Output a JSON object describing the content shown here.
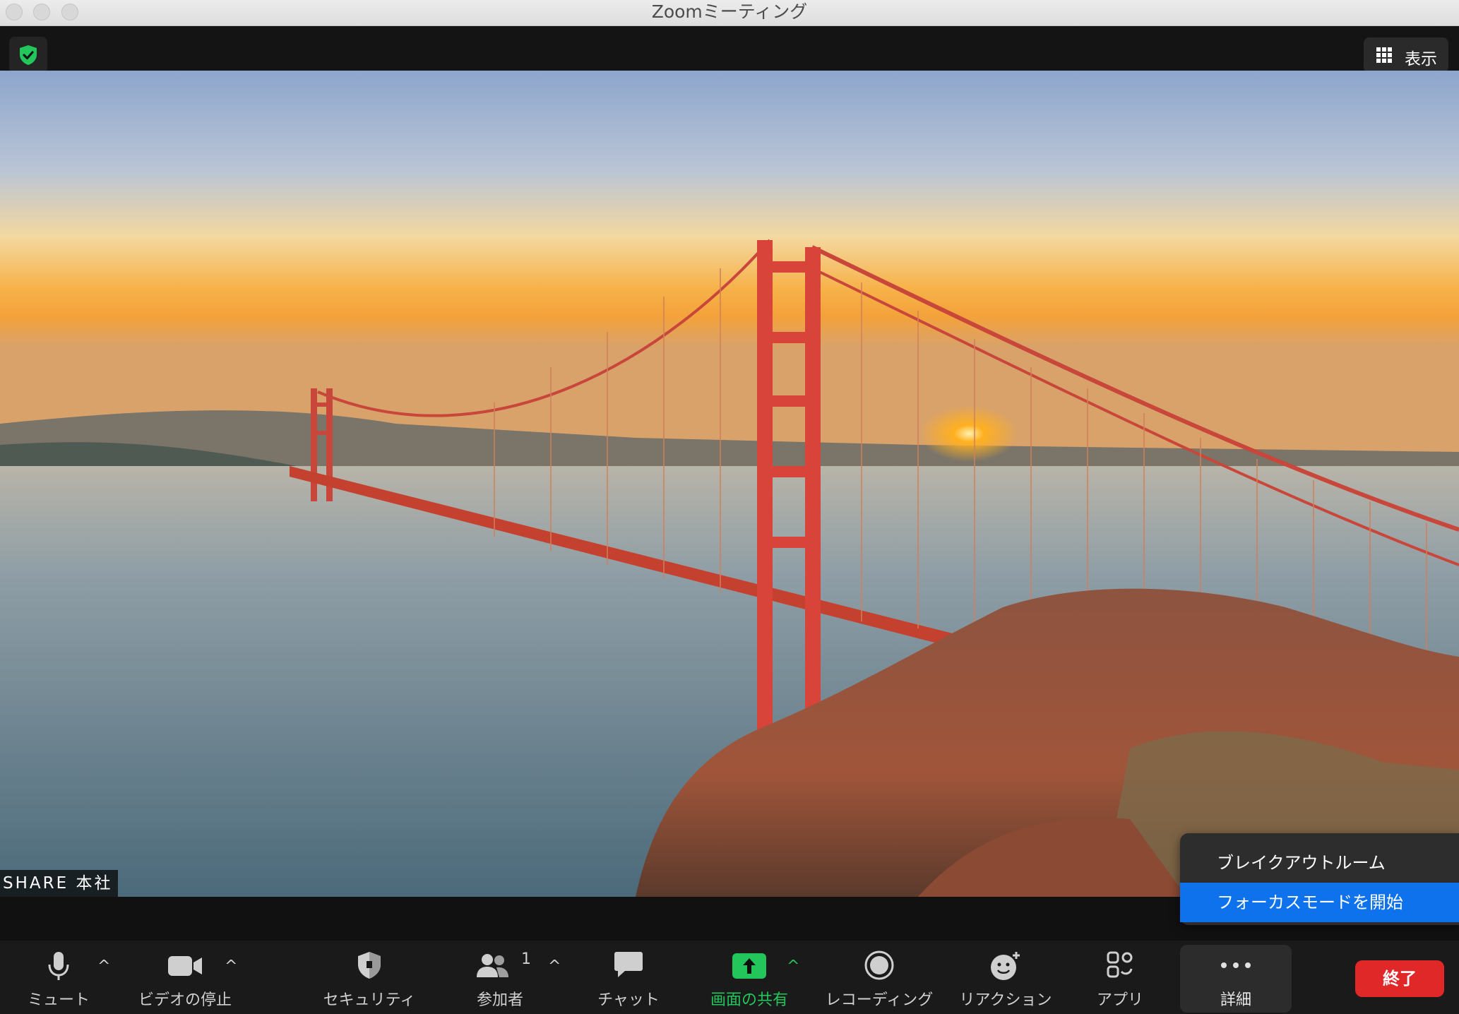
{
  "window": {
    "title": "Zoomミーティング"
  },
  "topbar": {
    "view_label": "表示"
  },
  "video": {
    "participant_name": "SHARE 本社"
  },
  "more_menu": {
    "items": [
      {
        "label": "ブレイクアウトルーム"
      },
      {
        "label": "フォーカスモードを開始"
      }
    ]
  },
  "toolbar": {
    "mute": "ミュート",
    "stop_video": "ビデオの停止",
    "security": "セキュリティ",
    "participants": "参加者",
    "participant_count": "1",
    "chat": "チャット",
    "share_screen": "画面の共有",
    "recording": "レコーディング",
    "reactions": "リアクション",
    "apps": "アプリ",
    "more": "詳細",
    "end": "終了"
  },
  "colors": {
    "share_green": "#22c65b",
    "end_red": "#e02828",
    "menu_highlight": "#0e72ed",
    "encryption_shield": "#22c65b"
  },
  "icons": {
    "encryption": "shield-check-icon",
    "view": "grid-icon",
    "mute": "microphone-icon",
    "video": "video-camera-icon",
    "security": "shield-icon",
    "participants": "people-icon",
    "chat": "chat-bubble-icon",
    "share": "share-arrow-icon",
    "record": "record-circle-icon",
    "reactions": "smile-plus-icon",
    "apps": "apps-icon",
    "more": "ellipsis-icon"
  }
}
